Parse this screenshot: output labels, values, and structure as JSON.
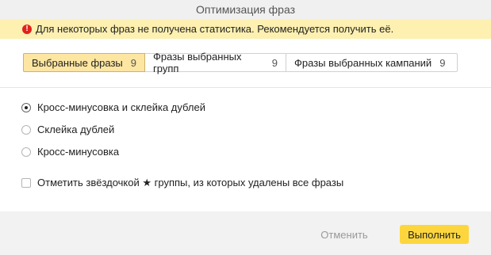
{
  "window": {
    "title": "Оптимизация фраз"
  },
  "warning": {
    "icon": "exclamation-icon",
    "text": "Для некоторых фраз не получена статистика. Рекомендуется получить её."
  },
  "tabs": [
    {
      "label": "Выбранные фразы",
      "count": "9",
      "active": true
    },
    {
      "label": "Фразы выбранных групп",
      "count": "9",
      "active": false
    },
    {
      "label": "Фразы выбранных кампаний",
      "count": "9",
      "active": false
    }
  ],
  "options": [
    {
      "label": "Кросс-минусовка и склейка дублей",
      "selected": true
    },
    {
      "label": "Склейка дублей",
      "selected": false
    },
    {
      "label": "Кросс-минусовка",
      "selected": false
    }
  ],
  "star_option": {
    "label": "Отметить звёздочкой ★ группы, из которых удалены все фразы",
    "checked": false
  },
  "footer": {
    "cancel_label": "Отменить",
    "run_label": "Выполнить"
  },
  "colors": {
    "warning_bg": "#fdf0b0",
    "active_tab_bg": "#fde6a2",
    "primary_button": "#fdd63e"
  }
}
